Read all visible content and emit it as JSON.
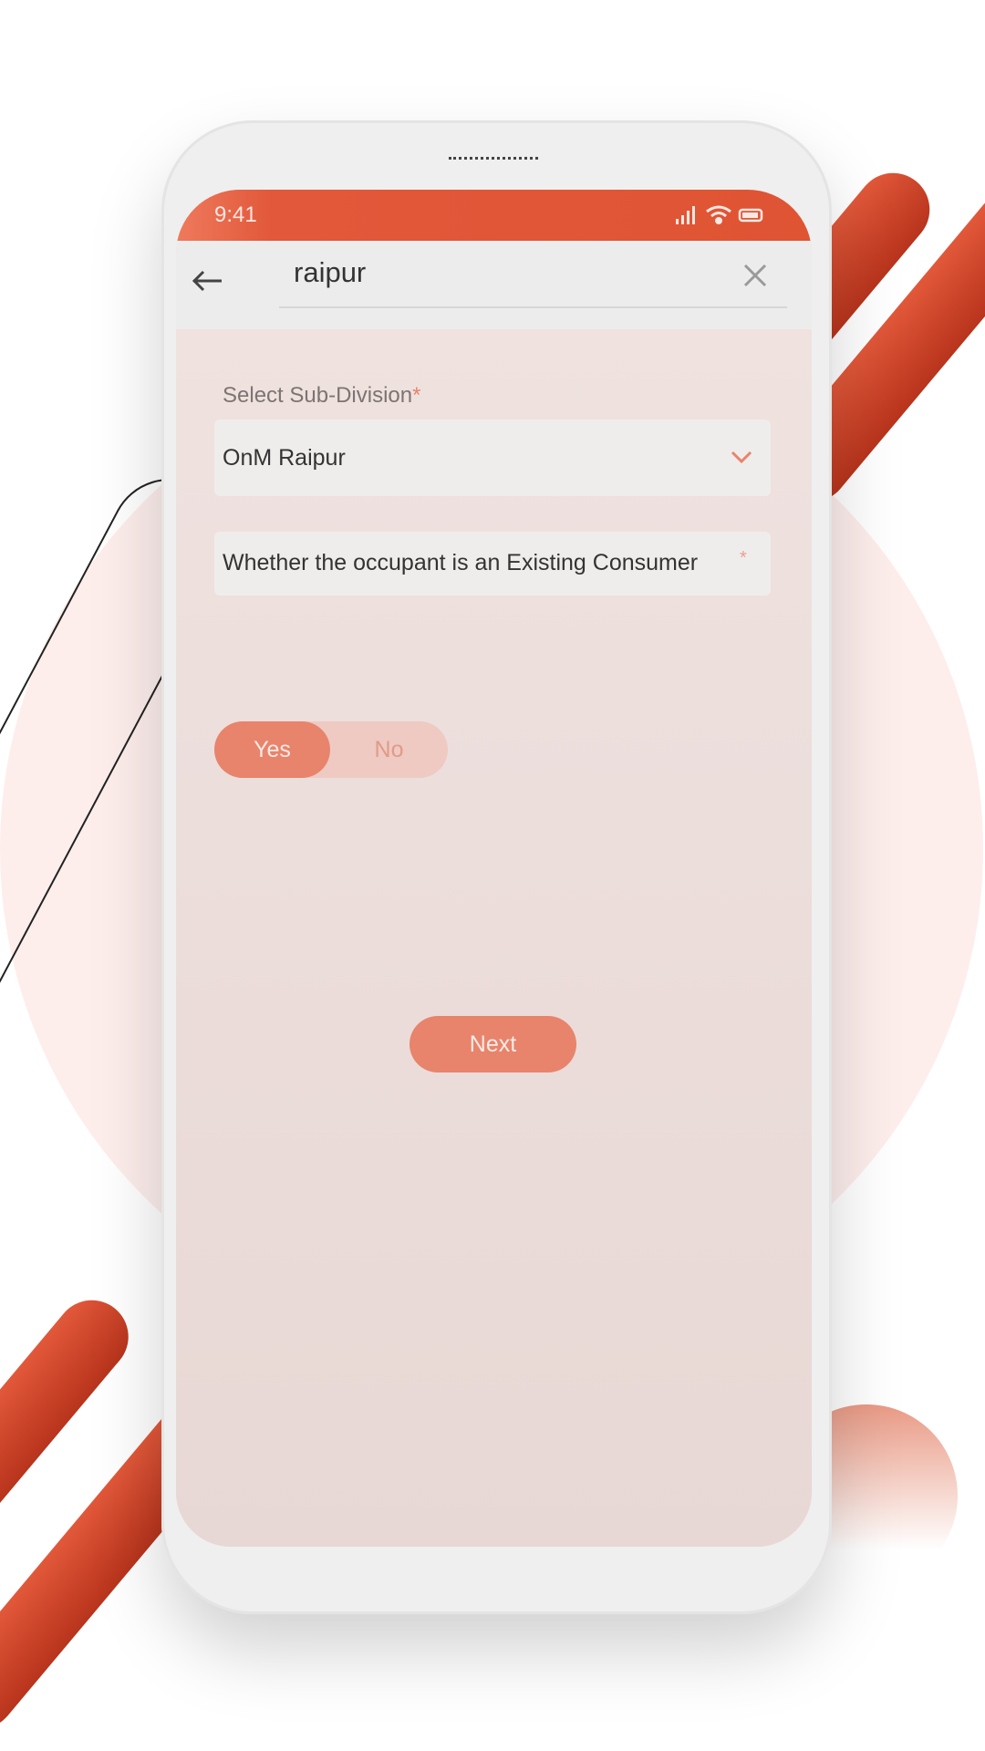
{
  "status_bar": {
    "time": "9:41"
  },
  "search": {
    "value": "raipur"
  },
  "form": {
    "subdivision_label": "Select Sub-Division",
    "required_mark": "*",
    "subdivision_value": "OnM Raipur",
    "question": "Whether the occupant is an Existing Consumer",
    "toggle": {
      "yes": "Yes",
      "no": "No",
      "selected": "Yes"
    },
    "next_label": "Next"
  },
  "colors": {
    "accent": "#e2583a",
    "button": "#e8846c"
  }
}
